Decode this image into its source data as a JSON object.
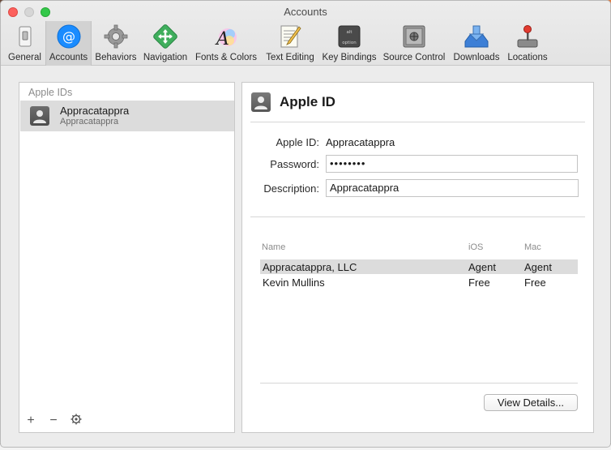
{
  "window": {
    "title": "Accounts"
  },
  "toolbar": {
    "tabs": [
      {
        "label": "General",
        "icon": "general-switch-icon"
      },
      {
        "label": "Accounts",
        "icon": "at-sign-icon",
        "active": true
      },
      {
        "label": "Behaviors",
        "icon": "gear-icon"
      },
      {
        "label": "Navigation",
        "icon": "navigation-arrows-icon"
      },
      {
        "label": "Fonts & Colors",
        "icon": "fonts-colors-icon"
      },
      {
        "label": "Text Editing",
        "icon": "text-editing-icon"
      },
      {
        "label": "Key Bindings",
        "icon": "key-bindings-icon"
      },
      {
        "label": "Source Control",
        "icon": "source-control-safe-icon"
      },
      {
        "label": "Downloads",
        "icon": "downloads-icon"
      },
      {
        "label": "Locations",
        "icon": "locations-joystick-icon"
      }
    ]
  },
  "sidebar": {
    "header": "Apple IDs",
    "accounts": [
      {
        "name": "Appracatappra",
        "subtitle": "Appracatappra"
      }
    ],
    "footer": {
      "add": "+",
      "remove": "−",
      "settings_icon": "gear-icon"
    }
  },
  "detail": {
    "title": "Apple ID",
    "apple_id_label": "Apple ID:",
    "apple_id_value": "Appracatappra",
    "password_label": "Password:",
    "password_value": "••••••••",
    "description_label": "Description:",
    "description_value": "Appracatappra",
    "teams": {
      "columns": [
        "Name",
        "iOS",
        "Mac"
      ],
      "rows": [
        {
          "name": "Appracatappra, LLC",
          "ios": "Agent",
          "mac": "Agent"
        },
        {
          "name": "Kevin Mullins",
          "ios": "Free",
          "mac": "Free"
        }
      ]
    },
    "view_details_label": "View Details..."
  },
  "colors": {
    "accent_blue": "#1a8cff",
    "selection_gray": "#dcdcdc",
    "close": "#fc605c",
    "maximize": "#34c84a"
  }
}
